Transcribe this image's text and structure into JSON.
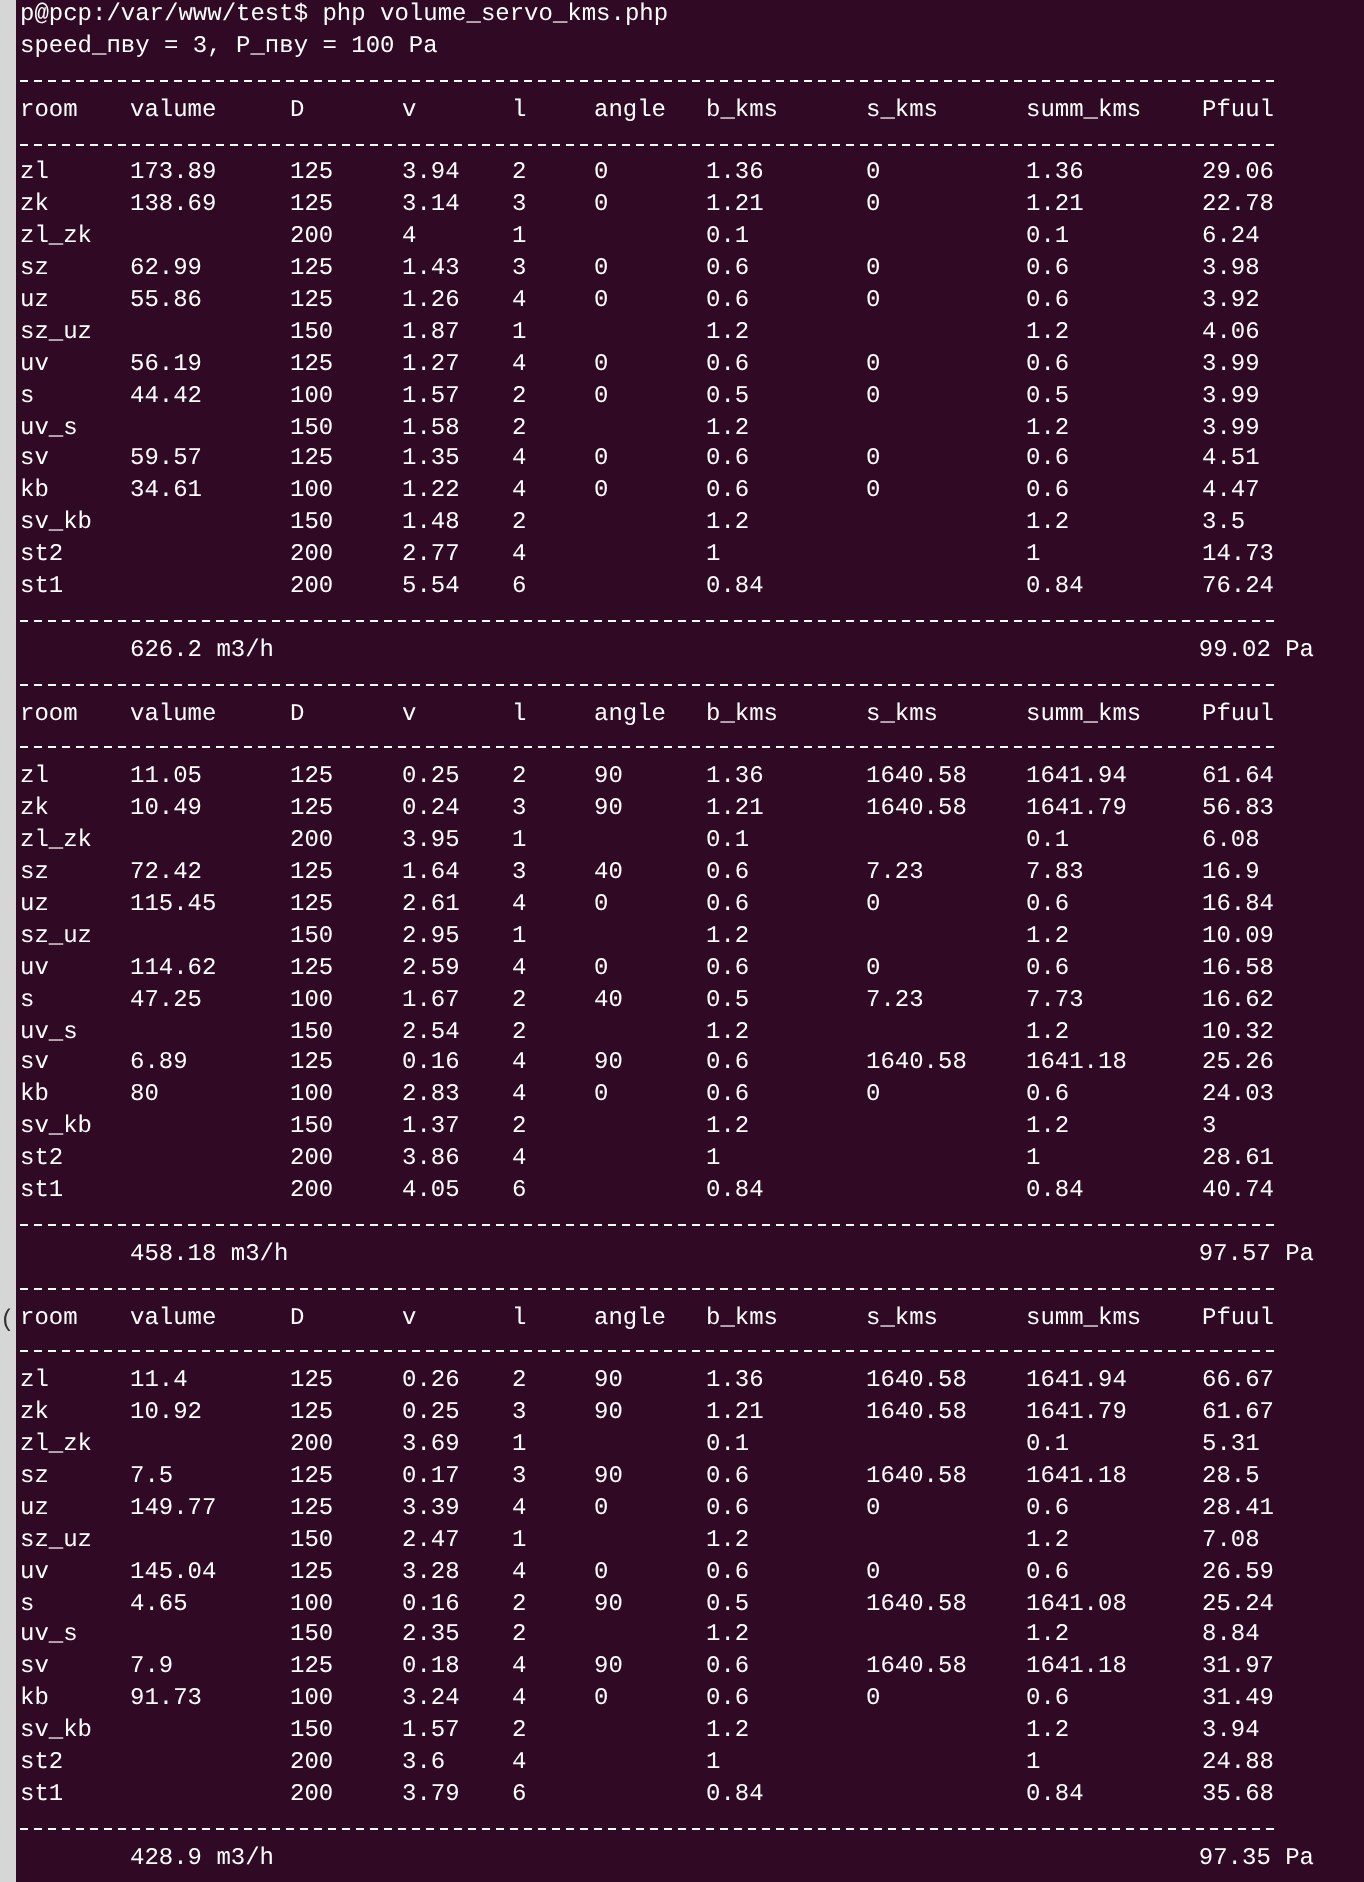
{
  "terminal": {
    "prompt_line": "p@pcp:/var/www/test$ php volume_servo_kms.php",
    "params_line": "speed_пву = 3, P_пву = 100 Pa",
    "margin_glyph": "(",
    "tables": [
      {
        "columns": [
          "room",
          "valume",
          "D",
          "v",
          "l",
          "angle",
          "b_kms",
          "s_kms",
          "summ_kms",
          "Pfuul"
        ],
        "rows": [
          [
            "zl",
            "173.89",
            "125",
            "3.94",
            "2",
            "0",
            "1.36",
            "0",
            "1.36",
            "29.06"
          ],
          [
            "zk",
            "138.69",
            "125",
            "3.14",
            "3",
            "0",
            "1.21",
            "0",
            "1.21",
            "22.78"
          ],
          [
            "zl_zk",
            null,
            "200",
            "4",
            "1",
            null,
            "0.1",
            null,
            "0.1",
            "6.24"
          ],
          [
            "sz",
            "62.99",
            "125",
            "1.43",
            "3",
            "0",
            "0.6",
            "0",
            "0.6",
            "3.98"
          ],
          [
            "uz",
            "55.86",
            "125",
            "1.26",
            "4",
            "0",
            "0.6",
            "0",
            "0.6",
            "3.92"
          ],
          [
            "sz_uz",
            null,
            "150",
            "1.87",
            "1",
            null,
            "1.2",
            null,
            "1.2",
            "4.06"
          ],
          [
            "uv",
            "56.19",
            "125",
            "1.27",
            "4",
            "0",
            "0.6",
            "0",
            "0.6",
            "3.99"
          ],
          [
            "s",
            "44.42",
            "100",
            "1.57",
            "2",
            "0",
            "0.5",
            "0",
            "0.5",
            "3.99"
          ],
          [
            "uv_s",
            null,
            "150",
            "1.58",
            "2",
            null,
            "1.2",
            null,
            "1.2",
            "3.99"
          ],
          [
            "sv",
            "59.57",
            "125",
            "1.35",
            "4",
            "0",
            "0.6",
            "0",
            "0.6",
            "4.51"
          ],
          [
            "kb",
            "34.61",
            "100",
            "1.22",
            "4",
            "0",
            "0.6",
            "0",
            "0.6",
            "4.47"
          ],
          [
            "sv_kb",
            null,
            "150",
            "1.48",
            "2",
            null,
            "1.2",
            null,
            "1.2",
            "3.5"
          ],
          [
            "st2",
            null,
            "200",
            "2.77",
            "4",
            null,
            "1",
            null,
            "1",
            "14.73"
          ],
          [
            "st1",
            null,
            "200",
            "5.54",
            "6",
            null,
            "0.84",
            null,
            "0.84",
            "76.24"
          ]
        ],
        "total_flow": "626.2 m3/h",
        "total_pressure": "99.02 Pa"
      },
      {
        "columns": [
          "room",
          "valume",
          "D",
          "v",
          "l",
          "angle",
          "b_kms",
          "s_kms",
          "summ_kms",
          "Pfuul"
        ],
        "rows": [
          [
            "zl",
            "11.05",
            "125",
            "0.25",
            "2",
            "90",
            "1.36",
            "1640.58",
            "1641.94",
            "61.64"
          ],
          [
            "zk",
            "10.49",
            "125",
            "0.24",
            "3",
            "90",
            "1.21",
            "1640.58",
            "1641.79",
            "56.83"
          ],
          [
            "zl_zk",
            null,
            "200",
            "3.95",
            "1",
            null,
            "0.1",
            null,
            "0.1",
            "6.08"
          ],
          [
            "sz",
            "72.42",
            "125",
            "1.64",
            "3",
            "40",
            "0.6",
            "7.23",
            "7.83",
            "16.9"
          ],
          [
            "uz",
            "115.45",
            "125",
            "2.61",
            "4",
            "0",
            "0.6",
            "0",
            "0.6",
            "16.84"
          ],
          [
            "sz_uz",
            null,
            "150",
            "2.95",
            "1",
            null,
            "1.2",
            null,
            "1.2",
            "10.09"
          ],
          [
            "uv",
            "114.62",
            "125",
            "2.59",
            "4",
            "0",
            "0.6",
            "0",
            "0.6",
            "16.58"
          ],
          [
            "s",
            "47.25",
            "100",
            "1.67",
            "2",
            "40",
            "0.5",
            "7.23",
            "7.73",
            "16.62"
          ],
          [
            "uv_s",
            null,
            "150",
            "2.54",
            "2",
            null,
            "1.2",
            null,
            "1.2",
            "10.32"
          ],
          [
            "sv",
            "6.89",
            "125",
            "0.16",
            "4",
            "90",
            "0.6",
            "1640.58",
            "1641.18",
            "25.26"
          ],
          [
            "kb",
            "80",
            "100",
            "2.83",
            "4",
            "0",
            "0.6",
            "0",
            "0.6",
            "24.03"
          ],
          [
            "sv_kb",
            null,
            "150",
            "1.37",
            "2",
            null,
            "1.2",
            null,
            "1.2",
            "3"
          ],
          [
            "st2",
            null,
            "200",
            "3.86",
            "4",
            null,
            "1",
            null,
            "1",
            "28.61"
          ],
          [
            "st1",
            null,
            "200",
            "4.05",
            "6",
            null,
            "0.84",
            null,
            "0.84",
            "40.74"
          ]
        ],
        "total_flow": "458.18 m3/h",
        "total_pressure": "97.57 Pa"
      },
      {
        "columns": [
          "room",
          "valume",
          "D",
          "v",
          "l",
          "angle",
          "b_kms",
          "s_kms",
          "summ_kms",
          "Pfuul"
        ],
        "rows": [
          [
            "zl",
            "11.4",
            "125",
            "0.26",
            "2",
            "90",
            "1.36",
            "1640.58",
            "1641.94",
            "66.67"
          ],
          [
            "zk",
            "10.92",
            "125",
            "0.25",
            "3",
            "90",
            "1.21",
            "1640.58",
            "1641.79",
            "61.67"
          ],
          [
            "zl_zk",
            null,
            "200",
            "3.69",
            "1",
            null,
            "0.1",
            null,
            "0.1",
            "5.31"
          ],
          [
            "sz",
            "7.5",
            "125",
            "0.17",
            "3",
            "90",
            "0.6",
            "1640.58",
            "1641.18",
            "28.5"
          ],
          [
            "uz",
            "149.77",
            "125",
            "3.39",
            "4",
            "0",
            "0.6",
            "0",
            "0.6",
            "28.41"
          ],
          [
            "sz_uz",
            null,
            "150",
            "2.47",
            "1",
            null,
            "1.2",
            null,
            "1.2",
            "7.08"
          ],
          [
            "uv",
            "145.04",
            "125",
            "3.28",
            "4",
            "0",
            "0.6",
            "0",
            "0.6",
            "26.59"
          ],
          [
            "s",
            "4.65",
            "100",
            "0.16",
            "2",
            "90",
            "0.5",
            "1640.58",
            "1641.08",
            "25.24"
          ],
          [
            "uv_s",
            null,
            "150",
            "2.35",
            "2",
            null,
            "1.2",
            null,
            "1.2",
            "8.84"
          ],
          [
            "sv",
            "7.9",
            "125",
            "0.18",
            "4",
            "90",
            "0.6",
            "1640.58",
            "1641.18",
            "31.97"
          ],
          [
            "kb",
            "91.73",
            "100",
            "3.24",
            "4",
            "0",
            "0.6",
            "0",
            "0.6",
            "31.49"
          ],
          [
            "sv_kb",
            null,
            "150",
            "1.57",
            "2",
            null,
            "1.2",
            null,
            "1.2",
            "3.94"
          ],
          [
            "st2",
            null,
            "200",
            "3.6",
            "4",
            null,
            "1",
            null,
            "1",
            "24.88"
          ],
          [
            "st1",
            null,
            "200",
            "3.79",
            "6",
            null,
            "0.84",
            null,
            "0.84",
            "35.68"
          ]
        ],
        "total_flow": "428.9 m3/h",
        "total_pressure": "97.35 Pa"
      }
    ]
  }
}
